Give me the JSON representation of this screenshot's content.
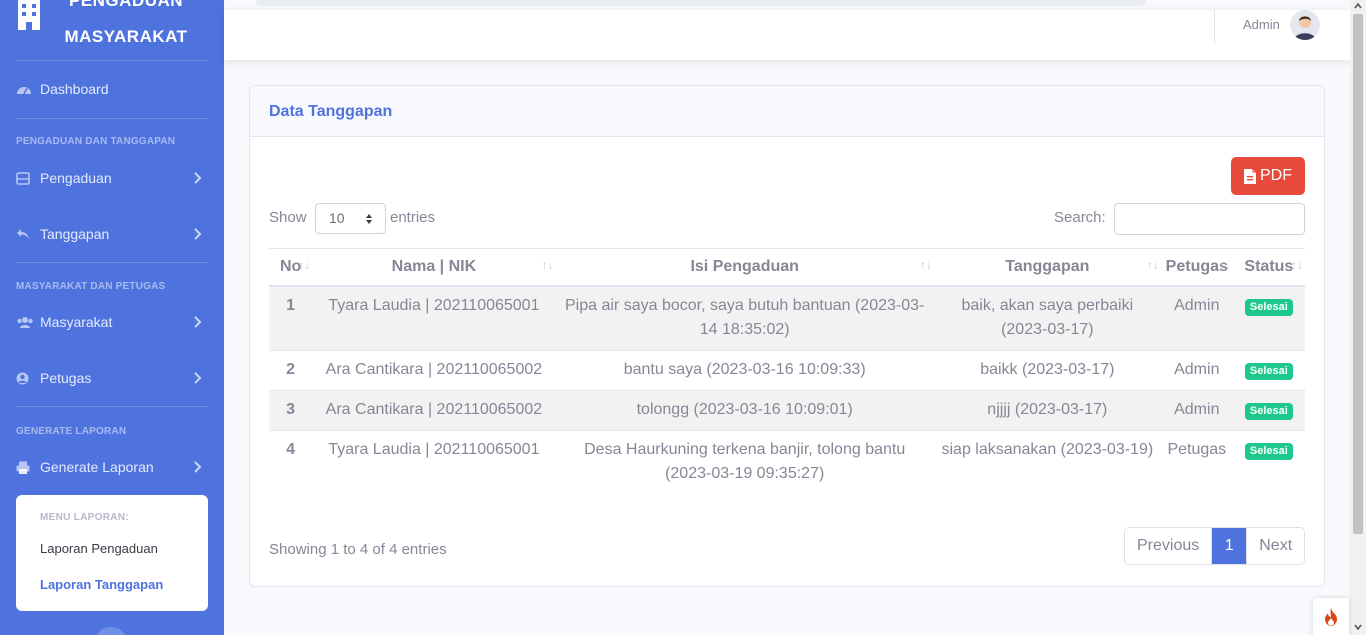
{
  "sidebar": {
    "brand_line1": "PENGADUAN",
    "brand_line2": "MASYARAKAT",
    "dashboard": "Dashboard",
    "heading_1": "PENGADUAN DAN TANGGAPAN",
    "pengaduan": "Pengaduan",
    "tanggapan": "Tanggapan",
    "heading_2": "MASYARAKAT DAN PETUGAS",
    "masyarakat": "Masyarakat",
    "petugas": "Petugas",
    "heading_3": "GENERATE LAPORAN",
    "generate": "Generate Laporan",
    "submenu_heading": "MENU LAPORAN:",
    "submenu_items": [
      "Laporan Pengaduan",
      "Laporan Tanggapan"
    ]
  },
  "topbar": {
    "user_name": "Admin"
  },
  "card": {
    "title": "Data Tanggapan",
    "pdf_label": "PDF",
    "show_label": "Show",
    "entries_label": "entries",
    "page_length": "10",
    "search_label": "Search:",
    "search_value": ""
  },
  "table": {
    "columns": [
      "No",
      "Nama | NIK",
      "Isi Pengaduan",
      "Tanggapan",
      "Petugas",
      "Status"
    ],
    "rows": [
      {
        "no": "1",
        "nama": "Tyara Laudia | 202110065001",
        "isi": "Pipa air saya bocor, saya butuh bantuan (2023-03-14 18:35:02)",
        "tanggapan": "baik, akan saya perbaiki (2023-03-17)",
        "petugas": "Admin",
        "status": "Selesai"
      },
      {
        "no": "2",
        "nama": "Ara Cantikara | 202110065002",
        "isi": "bantu saya (2023-03-16 10:09:33)",
        "tanggapan": "baikk (2023-03-17)",
        "petugas": "Admin",
        "status": "Selesai"
      },
      {
        "no": "3",
        "nama": "Ara Cantikara | 202110065002",
        "isi": "tolongg (2023-03-16 10:09:01)",
        "tanggapan": "njjjj (2023-03-17)",
        "petugas": "Admin",
        "status": "Selesai"
      },
      {
        "no": "4",
        "nama": "Tyara Laudia | 202110065001",
        "isi": "Desa Haurkuning terkena banjir, tolong bantu (2023-03-19 09:35:27)",
        "tanggapan": "siap laksanakan (2023-03-19)",
        "petugas": "Petugas",
        "status": "Selesai"
      }
    ]
  },
  "footer": {
    "info": "Showing 1 to 4 of 4 entries",
    "prev": "Previous",
    "page": "1",
    "next": "Next"
  },
  "colors": {
    "primary": "#4e73df",
    "danger": "#e74a3b",
    "success": "#1cc88a"
  }
}
